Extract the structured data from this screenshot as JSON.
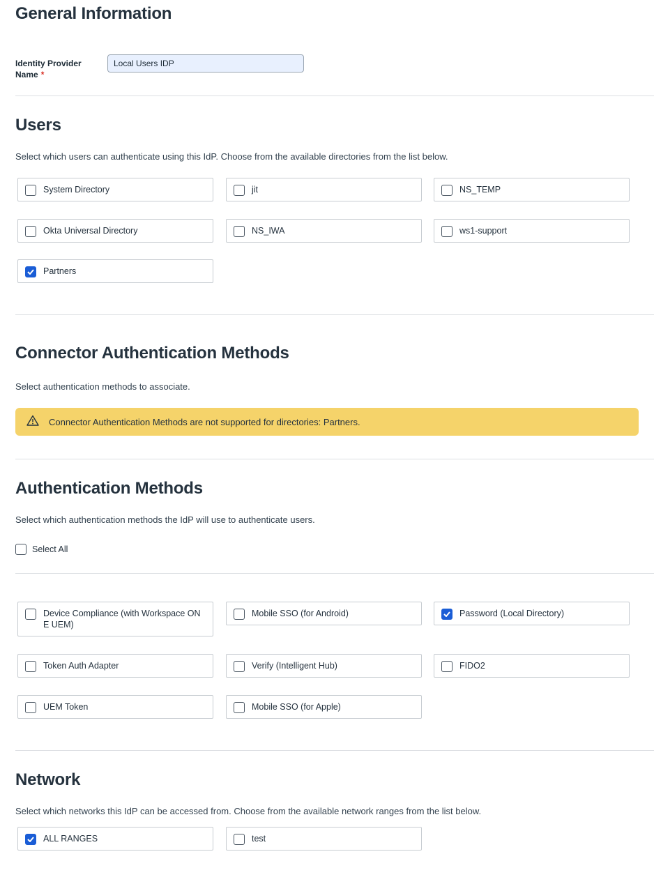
{
  "general": {
    "title": "General Information",
    "idp_name_label_line1": "Identity Provider",
    "idp_name_label_line2": "Name",
    "required_mark": "*",
    "idp_name_value": "Local Users IDP"
  },
  "users": {
    "title": "Users",
    "description": "Select which users can authenticate using this IdP. Choose from the available directories from the list below.",
    "directories": [
      {
        "label": "System Directory",
        "checked": false
      },
      {
        "label": "jit",
        "checked": false
      },
      {
        "label": "NS_TEMP",
        "checked": false
      },
      {
        "label": "Okta Universal Directory",
        "checked": false
      },
      {
        "label": "NS_IWA",
        "checked": false
      },
      {
        "label": "ws1-support",
        "checked": false
      },
      {
        "label": "Partners",
        "checked": true
      }
    ]
  },
  "connector": {
    "title": "Connector Authentication Methods",
    "description": "Select authentication methods to associate.",
    "warning": "Connector Authentication Methods are not supported for directories: Partners."
  },
  "auth_methods": {
    "title": "Authentication Methods",
    "description": "Select which authentication methods the IdP will use to authenticate users.",
    "select_all_label": "Select All",
    "methods": [
      {
        "label": "Device Compliance (with Workspace ON E UEM)",
        "checked": false
      },
      {
        "label": "Mobile SSO (for Android)",
        "checked": false
      },
      {
        "label": "Password (Local Directory)",
        "checked": true
      },
      {
        "label": "Token Auth Adapter",
        "checked": false
      },
      {
        "label": "Verify (Intelligent Hub)",
        "checked": false
      },
      {
        "label": "FIDO2",
        "checked": false
      },
      {
        "label": "UEM Token",
        "checked": false
      },
      {
        "label": "Mobile SSO (for Apple)",
        "checked": false
      }
    ]
  },
  "network": {
    "title": "Network",
    "description": "Select which networks this IdP can be accessed from. Choose from the available network ranges from the list below.",
    "ranges": [
      {
        "label": "ALL RANGES",
        "checked": true
      },
      {
        "label": "test",
        "checked": false
      }
    ]
  },
  "colors": {
    "checkbox_checked": "#1a5dd6",
    "warning_bg": "#f5d36a",
    "required": "#d93025"
  }
}
